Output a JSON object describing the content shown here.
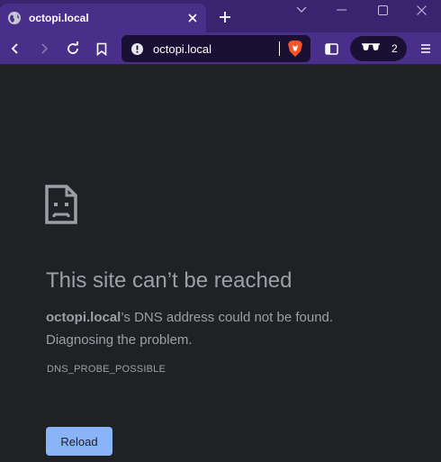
{
  "tab": {
    "title": "octopi.local",
    "icon": "globe-icon"
  },
  "toolbar": {
    "url": "octopi.local",
    "shields_count": "2"
  },
  "error": {
    "title": "This site can’t be reached",
    "host": "octopi.local",
    "desc_rest": "’s DNS address could not be found.",
    "desc_line2": "Diagnosing the problem.",
    "code": "DNS_PROBE_POSSIBLE",
    "reload_label": "Reload"
  },
  "colors": {
    "tab_bg": "#4a2f8a",
    "titlebar_bg": "#3b2370",
    "page_bg": "#202124",
    "text": "#9aa0a6",
    "button": "#8ab4f8",
    "brave": "#fb542b"
  }
}
